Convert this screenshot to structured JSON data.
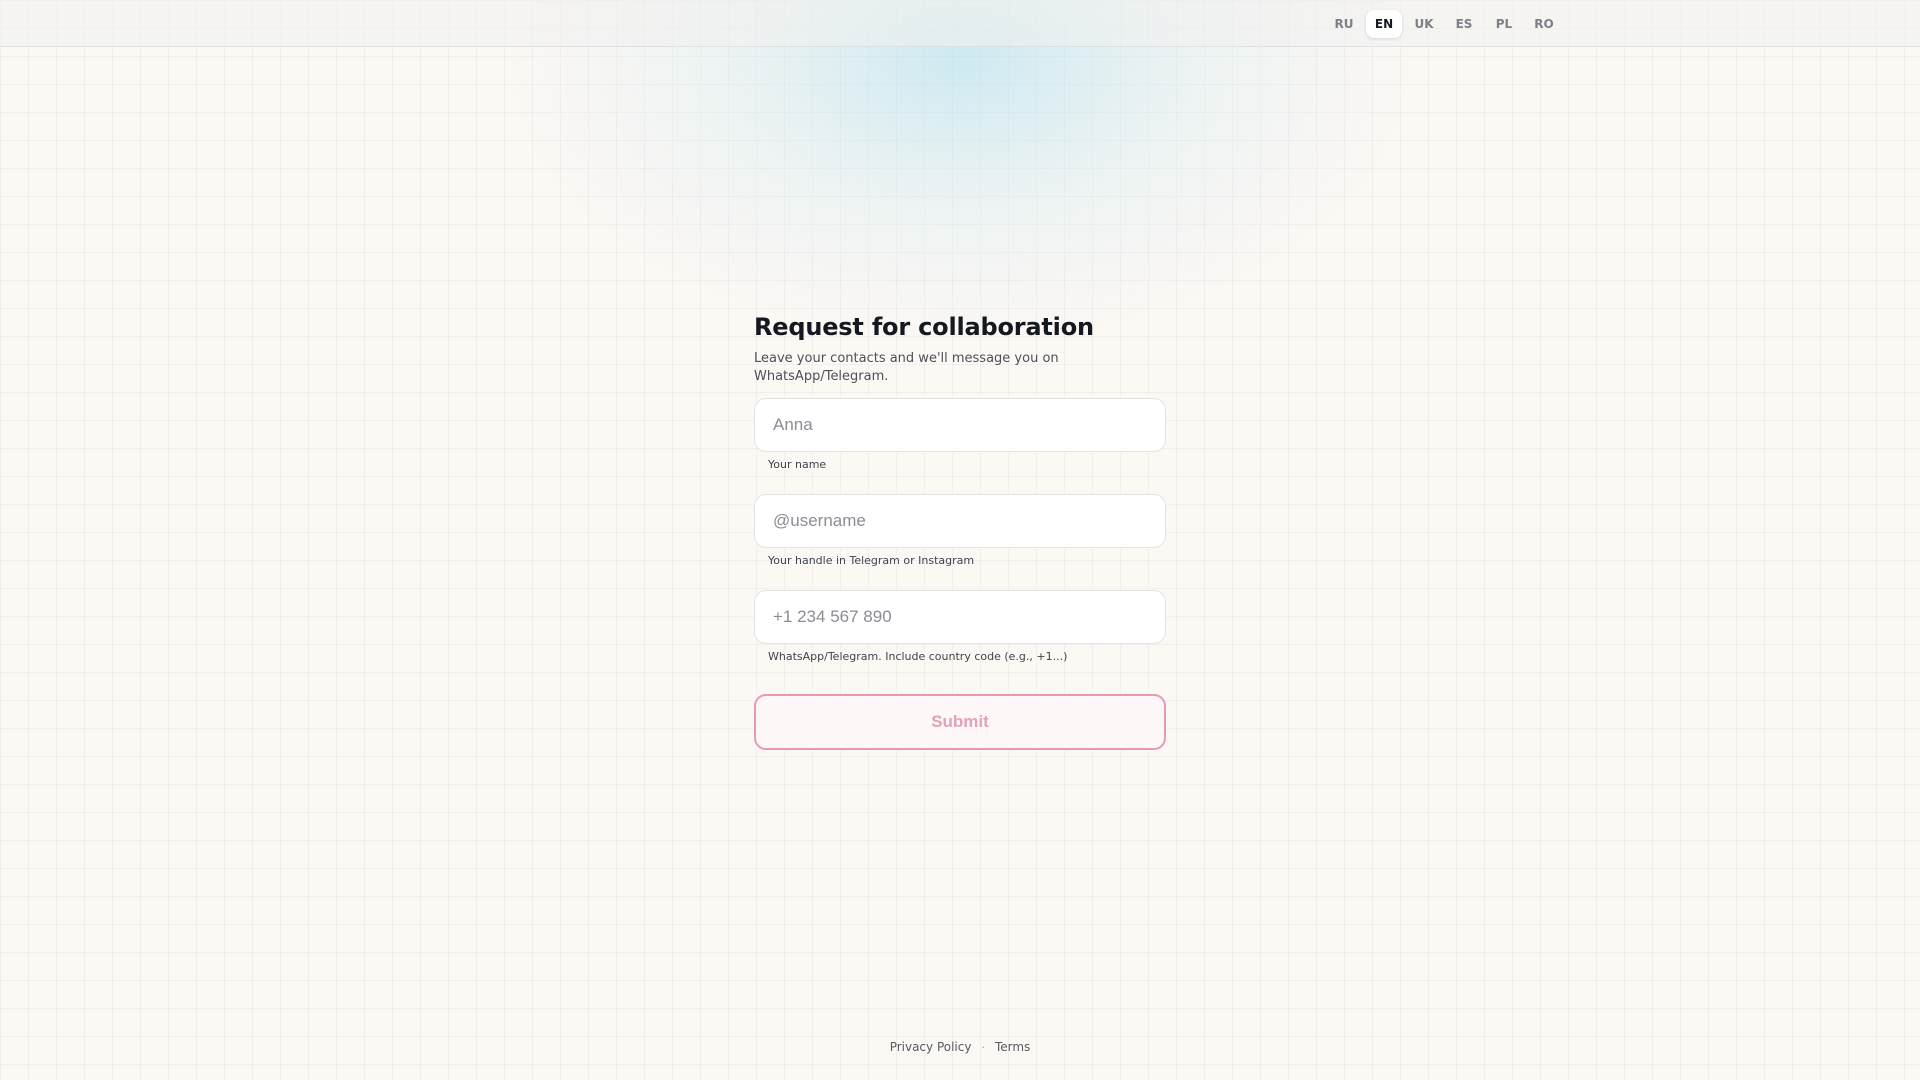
{
  "header": {
    "languages": [
      {
        "code": "RU",
        "active": false
      },
      {
        "code": "EN",
        "active": true
      },
      {
        "code": "UK",
        "active": false
      },
      {
        "code": "ES",
        "active": false
      },
      {
        "code": "PL",
        "active": false
      },
      {
        "code": "RO",
        "active": false
      }
    ]
  },
  "form": {
    "title": "Request for collaboration",
    "subtitle": "Leave your contacts and we'll message you on WhatsApp/Telegram.",
    "fields": [
      {
        "name": "name",
        "value": "",
        "placeholder": "Anna",
        "hint": "Your name"
      },
      {
        "name": "handle",
        "value": "",
        "placeholder": "@username",
        "hint": "Your handle in Telegram or Instagram"
      },
      {
        "name": "phone",
        "value": "",
        "placeholder": "+1 234 567 890",
        "hint": "WhatsApp/Telegram. Include country code (e.g., +1...)"
      }
    ],
    "submit_label": "Submit"
  },
  "footer": {
    "privacy_label": "Privacy Policy",
    "separator": "·",
    "terms_label": "Terms"
  },
  "colors": {
    "accent": "#e89ab4",
    "submit_text": "#e2a2b8",
    "background": "#fcf8f4"
  }
}
